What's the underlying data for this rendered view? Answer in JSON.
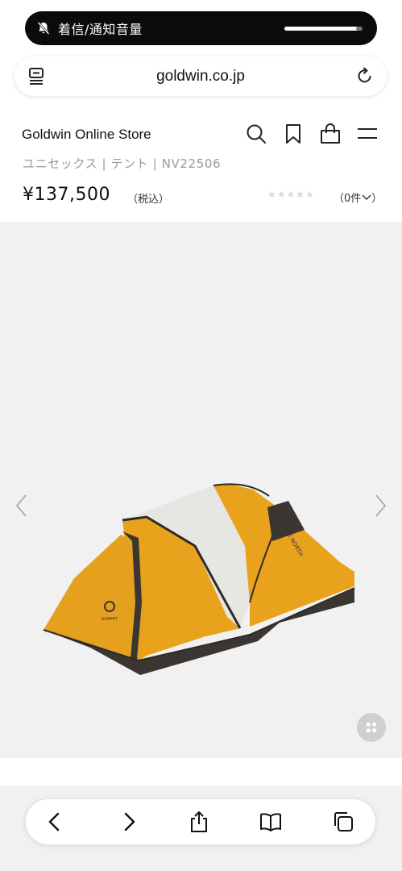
{
  "notification": {
    "text": "着信/通知音量",
    "icon": "bell-slash-icon"
  },
  "browser": {
    "url": "goldwin.co.jp"
  },
  "header": {
    "store_name": "Goldwin Online Store",
    "icons": [
      "search-icon",
      "bookmark-icon",
      "cart-icon",
      "menu-icon"
    ]
  },
  "product": {
    "breadcrumb": "ユニセックス | テント | NV22506",
    "price": "¥137,500",
    "tax_note": "（税込）",
    "rating_stars": "★★★★★",
    "review_count": "（0件",
    "image_icon": "tent-image"
  },
  "gallery": {
    "prev_icon": "chevron-left-icon",
    "next_icon": "chevron-right-icon",
    "grid_icon": "grid-icon"
  },
  "toolbar": {
    "icons": [
      "back-icon",
      "forward-icon",
      "share-icon",
      "bookmarks-icon",
      "tabs-icon"
    ]
  },
  "colors": {
    "tent_yellow": "#e9a21c",
    "tent_gray": "#e6e6e2",
    "tent_dark": "#3b3631",
    "page_bg": "#f1f1f1"
  }
}
